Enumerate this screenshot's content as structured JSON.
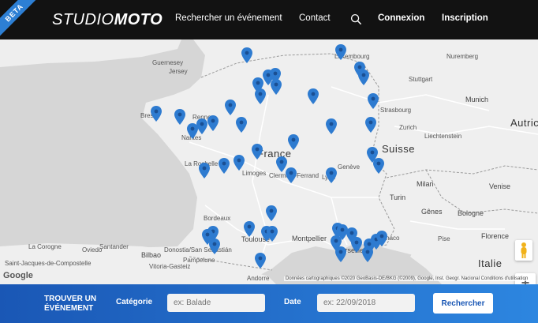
{
  "brand": {
    "badge": "BETA",
    "logo_part1": "STUDIO",
    "logo_part2": "MOTO"
  },
  "nav": {
    "search_event": "Rechercher un événement",
    "contact": "Contact",
    "login": "Connexion",
    "signup": "Inscription"
  },
  "map": {
    "labels": {
      "guernsey": "Guernesey",
      "jersey": "Jersey",
      "luxembourg": "Luxembourg",
      "nuremberg": "Nuremberg",
      "stuttgart": "Stuttgart",
      "munich": "Munich",
      "zurich": "Zurich",
      "austria": "Autric",
      "liechtenstein": "Liechtenstein",
      "switzerland": "Suisse",
      "france": "France",
      "limoges": "Limoges",
      "clermont": "Clermont-Ferrand",
      "lyon": "Lyon",
      "geneva": "Genève",
      "milan": "Milan",
      "venice": "Venise",
      "turin": "Turin",
      "bologna": "Bologne",
      "italy": "Italie",
      "larochelle": "La Rochelle",
      "bordeaux": "Bordeaux",
      "toulouse": "Toulouse",
      "montpellier": "Montpellier",
      "marseille": "Marseille",
      "monaco": "Monaco",
      "florence": "Florence",
      "genoa": "Gênes",
      "andorra": "Andorre",
      "bilbao": "Bilbao",
      "santiago": "Saint-Jacques-de-Compostelle",
      "lacoruna": "La Corogne",
      "vitoria": "Vitoria-Gasteiz",
      "pamplona": "Pampelune",
      "santander": "Santander",
      "oviedo": "Oviedo",
      "donostia": "Donostia/San Sebastián",
      "pisa": "Pise",
      "brest": "Brest",
      "rennes": "Rennes",
      "nantes": "Nantes",
      "strasbourg": "Strasbourg"
    },
    "google": "Google",
    "attribution": "Données cartographiques ©2020 GeoBasis-DE/BKG (©2009), Google, Inst. Geogr. Nacional   Conditions d'utilisation",
    "zoom_in": "+",
    "zoom_out": "−"
  },
  "search_bar": {
    "title_line1": "TROUVER UN",
    "title_line2": "ÉVÉNEMENT",
    "category_label": "Catégorie",
    "category_placeholder": "ex: Balade",
    "date_label": "Date",
    "date_placeholder": "ex: 22/09/2018",
    "submit": "Rechercher"
  },
  "colors": {
    "accent": "#2d7fd4",
    "pin": "#2e7bd0",
    "nav_bg": "#121212"
  },
  "icons": {
    "search": "search-icon",
    "marker": "map-marker-icon",
    "pegman": "pegman-icon"
  }
}
